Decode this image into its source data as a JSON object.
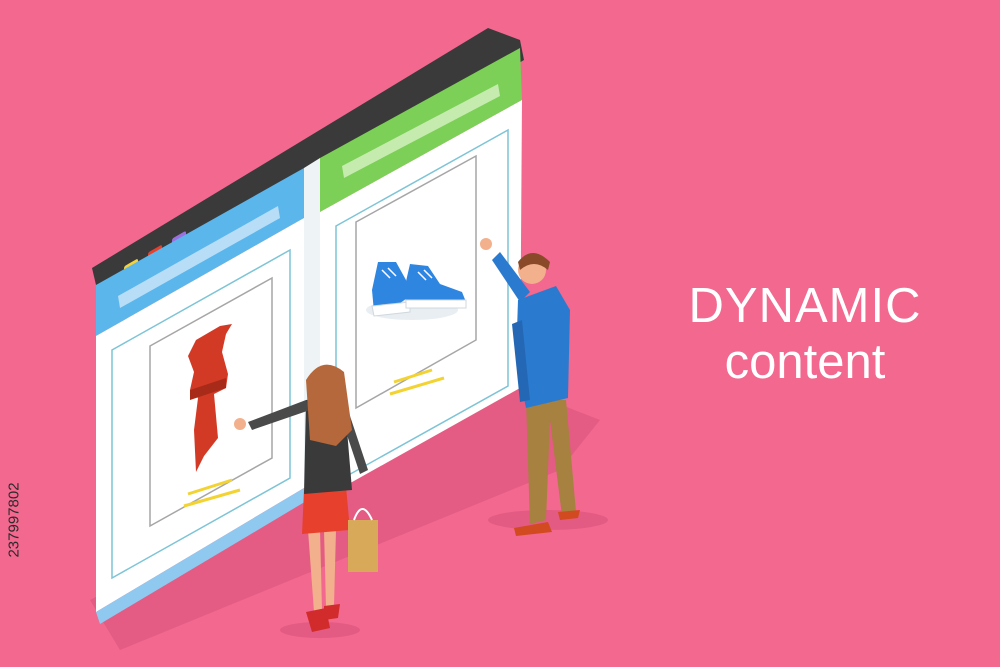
{
  "headline": {
    "line1": "DYNAMIC",
    "line2": "content"
  },
  "stock_id": "237997802",
  "colors": {
    "background": "#f2688f",
    "frame": "#3d3d3d",
    "left_header": "#5fb8ee",
    "right_header": "#7ed15a",
    "dress": "#d33a25",
    "shoes": "#2f86e0",
    "text_lines": "#f3d331"
  },
  "illustration": {
    "window_dots": [
      "yellow-dot",
      "red-dot",
      "purple-dot"
    ],
    "left_panel_product": "dress-icon",
    "right_panel_product": "sneakers-icon",
    "people": [
      "woman-with-shopping-bag",
      "man-pointing"
    ]
  }
}
